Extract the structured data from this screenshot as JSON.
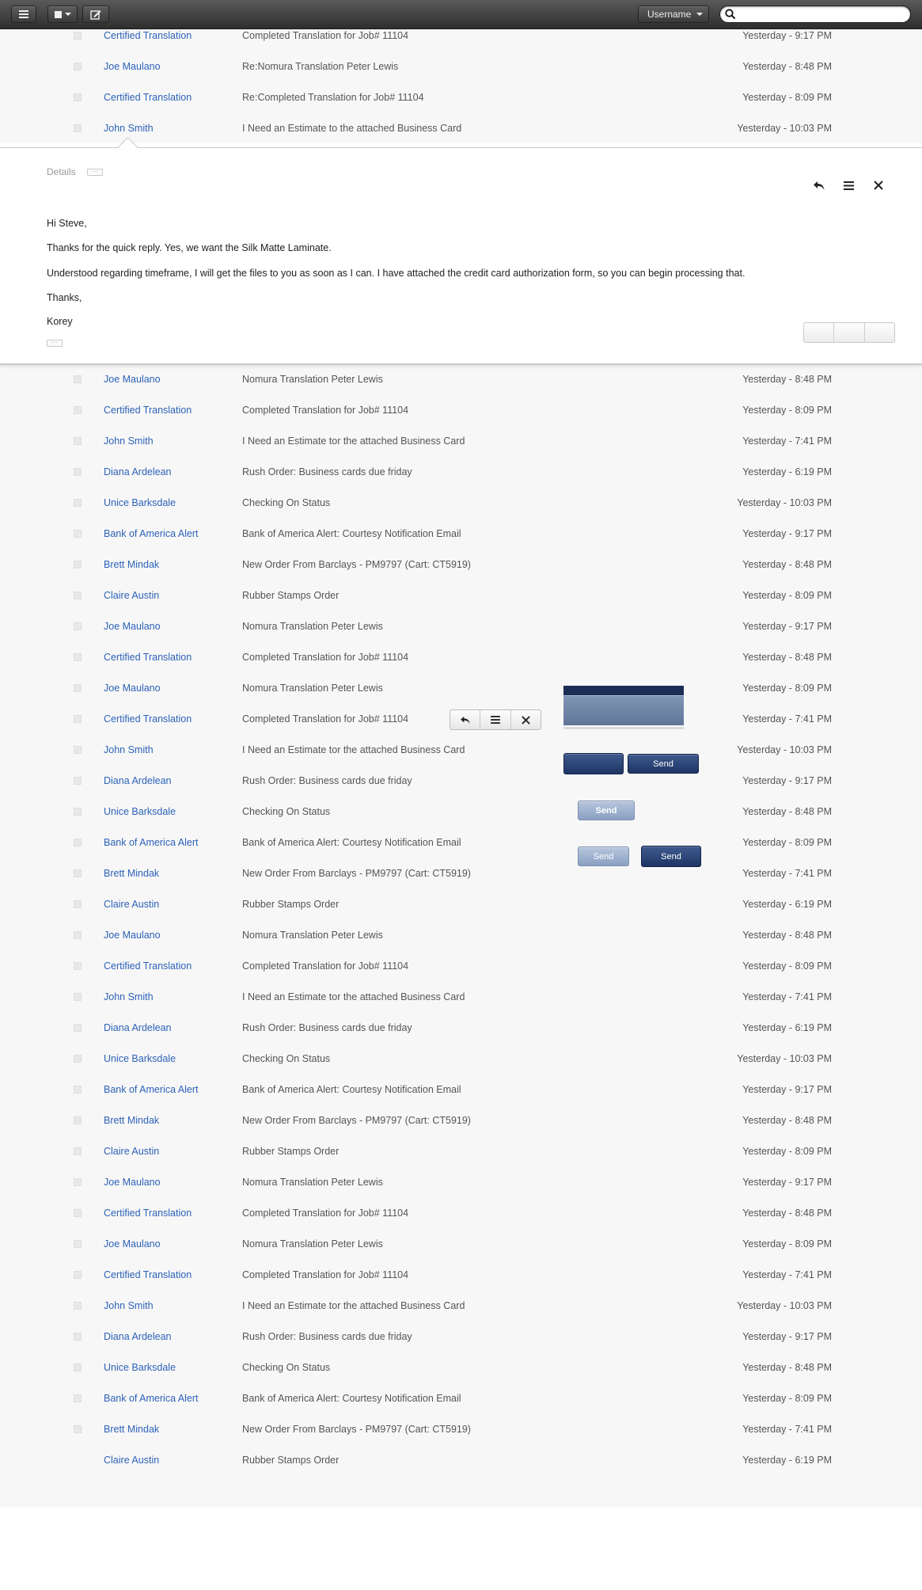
{
  "toolbar": {
    "username": "Username",
    "search_placeholder": ""
  },
  "list_top": [
    {
      "sender": "Certified Translation",
      "subject": "Completed Translation for Job# 11104",
      "date": "Yesterday - 9:17 PM"
    },
    {
      "sender": "Joe Maulano",
      "subject": "Re:Nomura Translation Peter Lewis",
      "date": "Yesterday - 8:48 PM"
    },
    {
      "sender": "Certified Translation",
      "subject": "Re:Completed Translation for Job# 11104",
      "date": "Yesterday - 8:09 PM"
    },
    {
      "sender": "John Smith",
      "subject": "I Need an Estimate to the attached Business Card",
      "date": "Yesterday - 10:03 PM"
    }
  ],
  "reading_pane": {
    "details_label": "Details",
    "dots": "···",
    "body": [
      "Hi Steve,",
      "Thanks for the quick reply. Yes, we want the Silk Matte Laminate.",
      "Understood regarding timeframe, I will get the files to you as soon as I can. I have attached the credit card authorization form, so you can begin processing that.",
      "Thanks,",
      "Korey"
    ]
  },
  "list_main": [
    {
      "sender": "Joe Maulano",
      "subject": "Nomura Translation Peter Lewis",
      "date": "Yesterday - 8:48 PM"
    },
    {
      "sender": "Certified Translation",
      "subject": "Completed Translation for Job# 11104",
      "date": "Yesterday - 8:09 PM"
    },
    {
      "sender": "John Smith",
      "subject": "I Need an Estimate tor the attached Business Card",
      "date": "Yesterday - 7:41 PM"
    },
    {
      "sender": "Diana Ardelean",
      "subject": "Rush Order: Business cards due friday",
      "date": "Yesterday - 6:19 PM"
    },
    {
      "sender": "Unice Barksdale",
      "subject": "Checking On Status",
      "date": "Yesterday - 10:03 PM"
    },
    {
      "sender": "Bank of America Alert",
      "subject": "Bank of America Alert: Courtesy Notification Email",
      "date": "Yesterday - 9:17 PM"
    },
    {
      "sender": "Brett Mindak",
      "subject": "New Order From Barclays - PM9797 (Cart: CT5919)",
      "date": "Yesterday - 8:48 PM"
    },
    {
      "sender": "Claire Austin",
      "subject": "Rubber Stamps Order",
      "date": "Yesterday - 8:09 PM"
    },
    {
      "sender": "Joe Maulano",
      "subject": "Nomura Translation Peter Lewis",
      "date": "Yesterday - 9:17 PM"
    },
    {
      "sender": "Certified Translation",
      "subject": "Completed Translation for Job# 11104",
      "date": "Yesterday - 8:48 PM"
    },
    {
      "sender": "Joe Maulano",
      "subject": "Nomura Translation Peter Lewis",
      "date": "Yesterday - 8:09 PM"
    },
    {
      "sender": "Certified Translation",
      "subject": "Completed Translation for Job# 11104",
      "date": "Yesterday - 7:41 PM"
    },
    {
      "sender": "John Smith",
      "subject": "I Need an Estimate tor the attached Business Card",
      "date": "Yesterday - 10:03 PM"
    },
    {
      "sender": "Diana Ardelean",
      "subject": "Rush Order: Business cards due friday",
      "date": "Yesterday - 9:17 PM"
    },
    {
      "sender": "Unice Barksdale",
      "subject": "Checking On Status",
      "date": "Yesterday - 8:48 PM"
    },
    {
      "sender": "Bank of America Alert",
      "subject": "Bank of America Alert: Courtesy Notification Email",
      "date": "Yesterday - 8:09 PM"
    },
    {
      "sender": "Brett Mindak",
      "subject": "New Order From Barclays - PM9797 (Cart: CT5919)",
      "date": "Yesterday - 7:41 PM"
    },
    {
      "sender": "Claire Austin",
      "subject": "Rubber Stamps Order",
      "date": "Yesterday - 6:19 PM"
    },
    {
      "sender": "Joe Maulano",
      "subject": "Nomura Translation Peter Lewis",
      "date": "Yesterday - 8:48 PM"
    },
    {
      "sender": "Certified Translation",
      "subject": "Completed Translation for Job# 11104",
      "date": "Yesterday - 8:09 PM"
    },
    {
      "sender": "John Smith",
      "subject": "I Need an Estimate tor the attached Business Card",
      "date": "Yesterday - 7:41 PM"
    },
    {
      "sender": "Diana Ardelean",
      "subject": "Rush Order: Business cards due friday",
      "date": "Yesterday - 6:19 PM"
    },
    {
      "sender": "Unice Barksdale",
      "subject": "Checking On Status",
      "date": "Yesterday - 10:03 PM"
    },
    {
      "sender": "Bank of America Alert",
      "subject": "Bank of America Alert: Courtesy Notification Email",
      "date": "Yesterday - 9:17 PM"
    },
    {
      "sender": "Brett Mindak",
      "subject": "New Order From Barclays - PM9797 (Cart: CT5919)",
      "date": "Yesterday - 8:48 PM"
    },
    {
      "sender": "Claire Austin",
      "subject": "Rubber Stamps Order",
      "date": "Yesterday - 8:09 PM"
    },
    {
      "sender": "Joe Maulano",
      "subject": "Nomura Translation Peter Lewis",
      "date": "Yesterday - 9:17 PM"
    },
    {
      "sender": "Certified Translation",
      "subject": "Completed Translation for Job# 11104",
      "date": "Yesterday - 8:48 PM"
    },
    {
      "sender": "Joe Maulano",
      "subject": "Nomura Translation Peter Lewis",
      "date": "Yesterday - 8:09 PM"
    },
    {
      "sender": "Certified Translation",
      "subject": "Completed Translation for Job# 11104",
      "date": "Yesterday - 7:41 PM"
    },
    {
      "sender": "John Smith",
      "subject": "I Need an Estimate tor the attached Business Card",
      "date": "Yesterday - 10:03 PM"
    },
    {
      "sender": "Diana Ardelean",
      "subject": "Rush Order: Business cards due friday",
      "date": "Yesterday - 9:17 PM"
    },
    {
      "sender": "Unice Barksdale",
      "subject": "Checking On Status",
      "date": "Yesterday - 8:48 PM"
    },
    {
      "sender": "Bank of America Alert",
      "subject": "Bank of America Alert: Courtesy Notification Email",
      "date": "Yesterday - 8:09 PM"
    },
    {
      "sender": "Brett Mindak",
      "subject": "New Order From Barclays - PM9797 (Cart: CT5919)",
      "date": "Yesterday - 7:41 PM"
    },
    {
      "sender": "Claire Austin",
      "subject": "Rubber Stamps Order",
      "date": "Yesterday - 6:19 PM"
    }
  ],
  "widgets": {
    "send_label": "Send",
    "colors": {
      "toolbar_dark": "#2e2e2e",
      "sender_link": "#2d62b8",
      "button_blue": "#1e3564",
      "button_light": "#8aa0c2"
    }
  }
}
